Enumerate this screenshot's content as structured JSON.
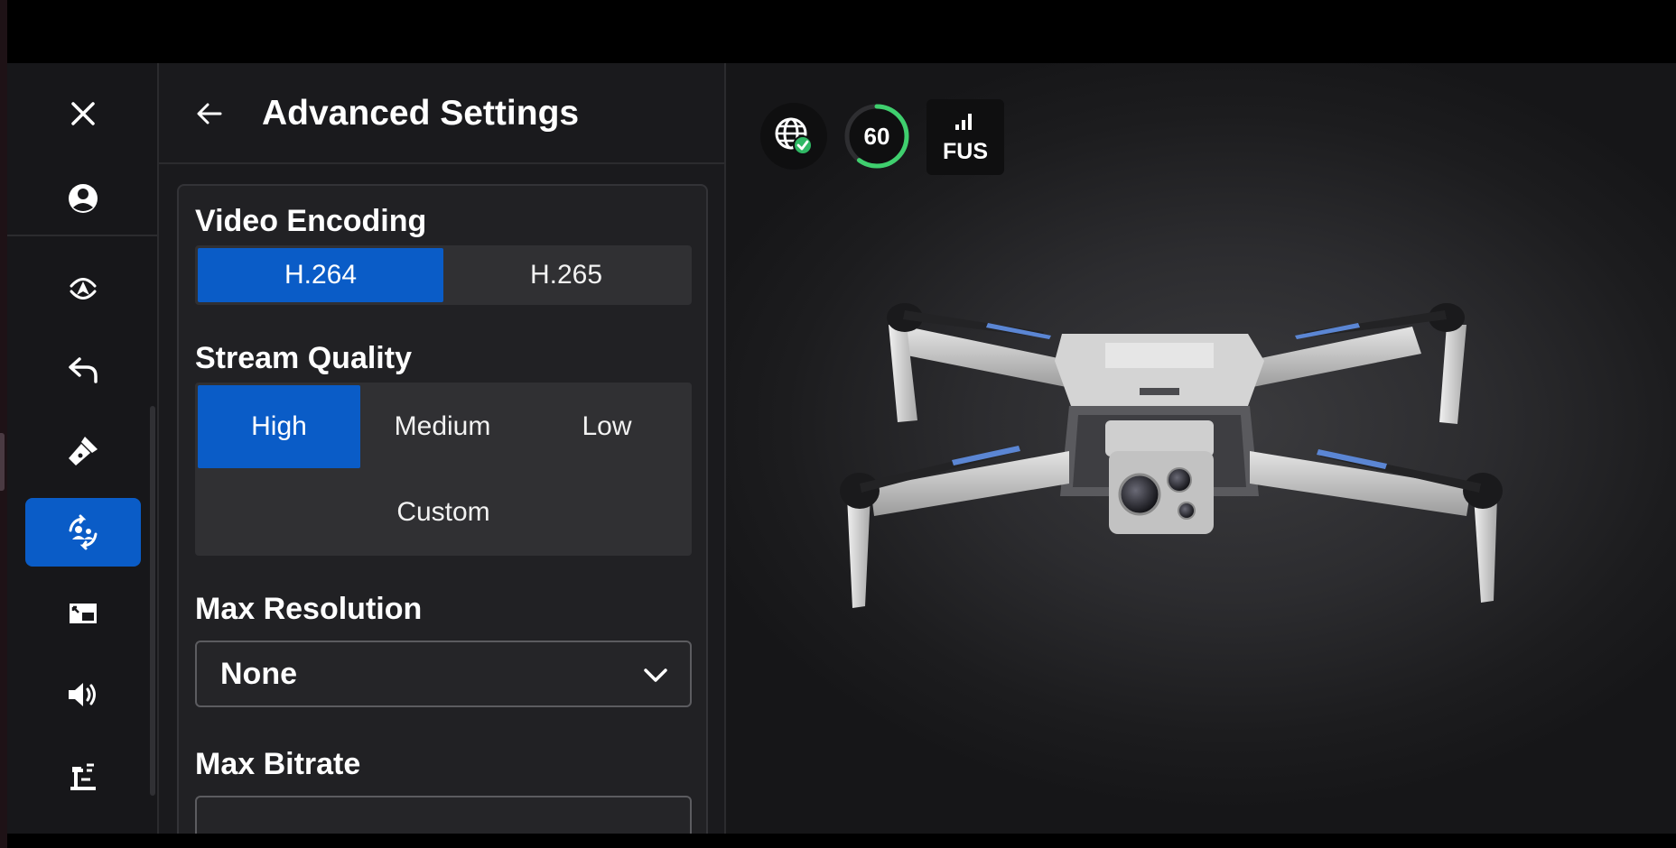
{
  "panel": {
    "title": "Advanced Settings"
  },
  "video_encoding": {
    "label": "Video Encoding",
    "options": [
      "H.264",
      "H.265"
    ],
    "selected": "H.264"
  },
  "stream_quality": {
    "label": "Stream Quality",
    "options": [
      "High",
      "Medium",
      "Low",
      "Custom"
    ],
    "selected": "High"
  },
  "max_resolution": {
    "label": "Max Resolution",
    "value": "None"
  },
  "max_bitrate": {
    "label": "Max Bitrate"
  },
  "status": {
    "battery": "60",
    "battery_level": 0.6,
    "signal_label": "FUS"
  },
  "rail": {
    "items": [
      "close-icon",
      "account-icon",
      "takeoff-icon",
      "return-icon",
      "flashlight-icon",
      "tracking-icon",
      "picture-in-picture-icon",
      "volume-icon",
      "attachment-icon"
    ],
    "active": "tracking-icon"
  },
  "colors": {
    "accent": "#0a5cc7",
    "battery_ok": "#3fcf6e",
    "connected": "#2fb864"
  }
}
